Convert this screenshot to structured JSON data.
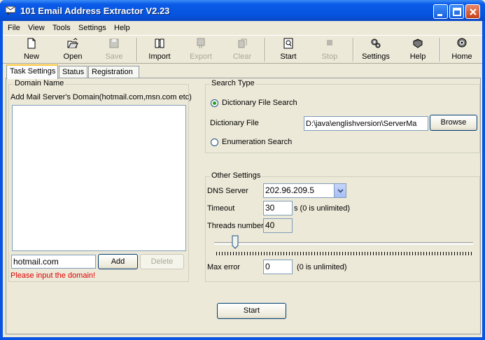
{
  "window": {
    "title": "101 Email Address Extractor V2.23"
  },
  "menu": [
    "File",
    "View",
    "Tools",
    "Settings",
    "Help"
  ],
  "toolbar": {
    "new": "New",
    "open": "Open",
    "save": "Save",
    "import": "Import",
    "export": "Export",
    "clear": "Clear",
    "start": "Start",
    "stop": "Stop",
    "settings": "Settings",
    "help": "Help",
    "home": "Home"
  },
  "tabs": [
    "Task Settings",
    "Status",
    "Registration"
  ],
  "domain": {
    "legend": "Domain Name",
    "instruction": "Add Mail Server's Domain(hotmail.com,msn.com etc)",
    "input_value": "hotmail.com",
    "add_label": "Add",
    "delete_label": "Delete",
    "error": "Please input the domain!"
  },
  "search_type": {
    "legend": "Search Type",
    "dictionary_option": "Dictionary File Search",
    "dictionary_label": "Dictionary File",
    "dictionary_value": "D:\\java\\englishversion\\ServerMa",
    "browse_label": "Browse",
    "enumeration_option": "Enumeration Search",
    "selected": "dictionary"
  },
  "other_settings": {
    "legend": "Other Settings",
    "dns_label": "DNS Server",
    "dns_value": "202.96.209.5",
    "timeout_label": "Timeout",
    "timeout_value": "30",
    "timeout_hint": "s (0 is unlimited)",
    "threads_label": "Threads number",
    "threads_value": "40",
    "threads_slider_fraction": 0.08,
    "max_error_label": "Max error",
    "max_error_value": "0",
    "max_error_hint": "(0 is unlimited)"
  },
  "start_button": "Start"
}
